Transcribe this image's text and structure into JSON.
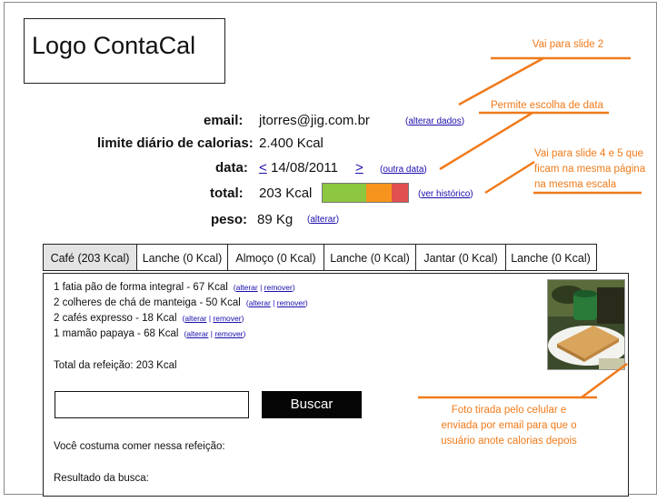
{
  "logo": {
    "text": "Logo ContaCal"
  },
  "profile": {
    "email_label": "email:",
    "email_value": "jtorres@jig.com.br",
    "email_link": "alterar dados",
    "limit_label": "limite diário de calorias:",
    "limit_value": "2.400 Kcal",
    "date_label": "data:",
    "date_prev": "<",
    "date_value": "14/08/2011",
    "date_next": ">",
    "date_link": "outra data",
    "total_label": "total:",
    "total_value": "203 Kcal",
    "total_link": "ver histórico",
    "weight_label": "peso:",
    "weight_value": "89 Kg",
    "weight_link": "alterar"
  },
  "gauge": {
    "segments": [
      {
        "color": "#8dc63f"
      },
      {
        "color": "#f7941d"
      },
      {
        "color": "#e05050"
      }
    ]
  },
  "tabs": [
    {
      "label": "Café (203 Kcal)",
      "active": true
    },
    {
      "label": "Lanche (0 Kcal)",
      "active": false
    },
    {
      "label": "Almoço (0 Kcal)",
      "active": false
    },
    {
      "label": "Lanche (0 Kcal)",
      "active": false
    },
    {
      "label": "Jantar (0 Kcal)",
      "active": false
    },
    {
      "label": "Lanche (0 Kcal)",
      "active": false
    }
  ],
  "meal": {
    "items": [
      {
        "text": "1 fatia pão de forma integral - 67 Kcal",
        "edit": "alterar",
        "remove": "remover"
      },
      {
        "text": "2 colheres de chá de manteiga - 50 Kcal",
        "edit": "alterar",
        "remove": "remover"
      },
      {
        "text": "2 cafés expresso  - 18 Kcal",
        "edit": "alterar",
        "remove": "remover"
      },
      {
        "text": "1 mamão papaya - 68 Kcal",
        "edit": "alterar",
        "remove": "remover"
      }
    ],
    "total": "Total da refeição: 203 Kcal",
    "search_button": "Buscar",
    "usual_label": "Você costuma comer nessa refeição:",
    "results_label": "Resultado da busca:"
  },
  "notes": {
    "slide2": "Vai para slide 2",
    "date_choice": "Permite escolha de data",
    "history_1": "Vai para slide 4 e 5 que",
    "history_2": "ficam na mesma página",
    "history_3": "na mesma escala",
    "photo_1": "Foto tirada pelo celular e",
    "photo_2": "enviada por email para que o",
    "photo_3": "usuário anote calorias depois"
  },
  "colors": {
    "annotation": "#f07a1a",
    "link": "#1a0dab"
  }
}
